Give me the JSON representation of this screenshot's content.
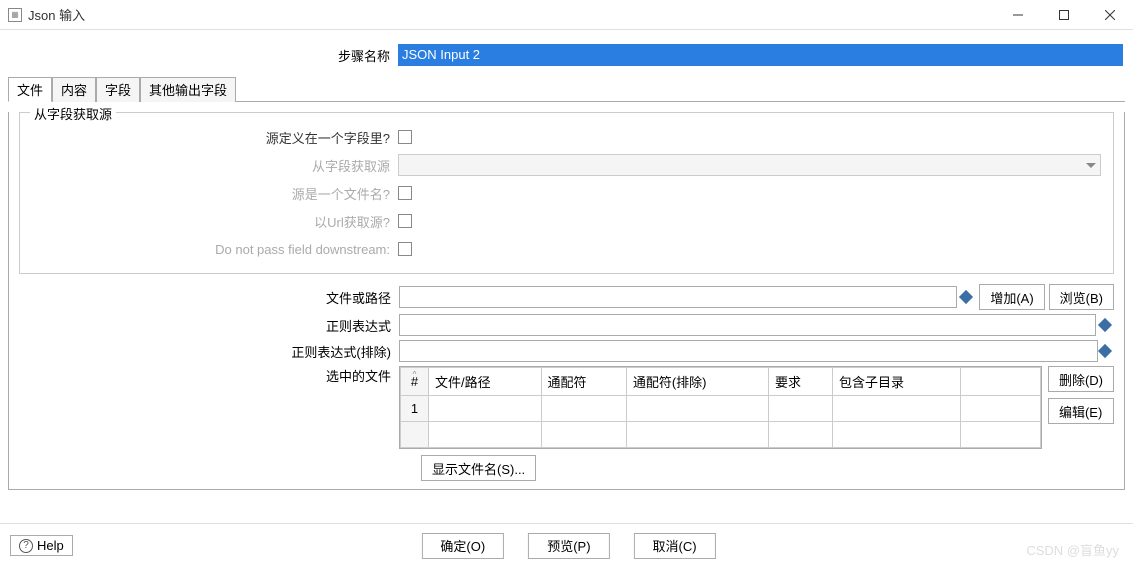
{
  "window": {
    "title": "Json 输入",
    "minimize": "—",
    "maximize": "☐",
    "close": "✕"
  },
  "step": {
    "label": "步骤名称",
    "value": "JSON Input 2"
  },
  "tabs": [
    "文件",
    "内容",
    "字段",
    "其他输出字段"
  ],
  "fieldset": {
    "legend": "从字段获取源",
    "rows": {
      "src_in_field": "源定义在一个字段里?",
      "get_from_field": "从字段获取源",
      "is_filename": "源是一个文件名?",
      "use_url": "以Url获取源?",
      "no_pass": "Do not pass field downstream:"
    }
  },
  "outer": {
    "file_or_path": "文件或路径",
    "regex": "正则表达式",
    "regex_exclude": "正则表达式(排除)",
    "selected_files": "选中的文件"
  },
  "buttons": {
    "add": "增加(A)",
    "browse": "浏览(B)",
    "delete": "删除(D)",
    "edit": "编辑(E)",
    "show": "显示文件名(S)...",
    "ok": "确定(O)",
    "preview": "预览(P)",
    "cancel": "取消(C)",
    "help": "Help"
  },
  "table": {
    "headers": [
      "#",
      "文件/路径",
      "通配符",
      "通配符(排除)",
      "要求",
      "包含子目录"
    ],
    "rows": [
      [
        "1",
        "",
        "",
        "",
        "",
        ""
      ]
    ]
  },
  "watermark": "CSDN @盲鱼yy"
}
